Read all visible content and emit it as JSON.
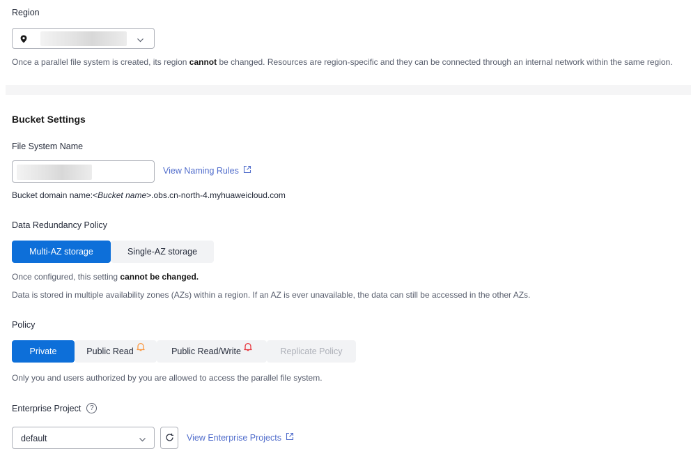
{
  "region": {
    "label": "Region",
    "note_before": "Once a parallel file system is created, its region ",
    "note_bold": "cannot",
    "note_after": " be changed. Resources are region-specific and they can be connected through an internal network within the same region."
  },
  "bucket_settings": {
    "heading": "Bucket Settings",
    "file_system_name": {
      "label": "File System Name",
      "naming_rules_link": "View Naming Rules",
      "domain_prefix": "Bucket domain name:<",
      "domain_italic": "Bucket name",
      "domain_suffix": ">.obs.cn-north-4.myhuaweicloud.com"
    },
    "redundancy": {
      "label": "Data Redundancy Policy",
      "options": [
        "Multi-AZ storage",
        "Single-AZ storage"
      ],
      "selected": "Multi-AZ storage",
      "note_before": "Once configured, this setting ",
      "note_bold": "cannot be changed.",
      "description": "Data is stored in multiple availability zones (AZs) within a region. If an AZ is ever unavailable, the data can still be accessed in the other AZs."
    },
    "policy": {
      "label": "Policy",
      "options": [
        "Private",
        "Public Read",
        "Public Read/Write",
        "Replicate Policy"
      ],
      "selected": "Private",
      "description": "Only you and users authorized by you are allowed to access the parallel file system.",
      "colors": {
        "warning_bell": "#fa9841",
        "danger_bell": "#e7353d"
      }
    },
    "enterprise_project": {
      "label": "Enterprise Project",
      "help_glyph": "?",
      "value": "default",
      "view_link": "View Enterprise Projects"
    }
  },
  "colors": {
    "primary": "#0d6fd9",
    "link": "#526ecc",
    "segment_inactive_bg": "#f2f3f5",
    "divider_bg": "#f5f5f6"
  }
}
